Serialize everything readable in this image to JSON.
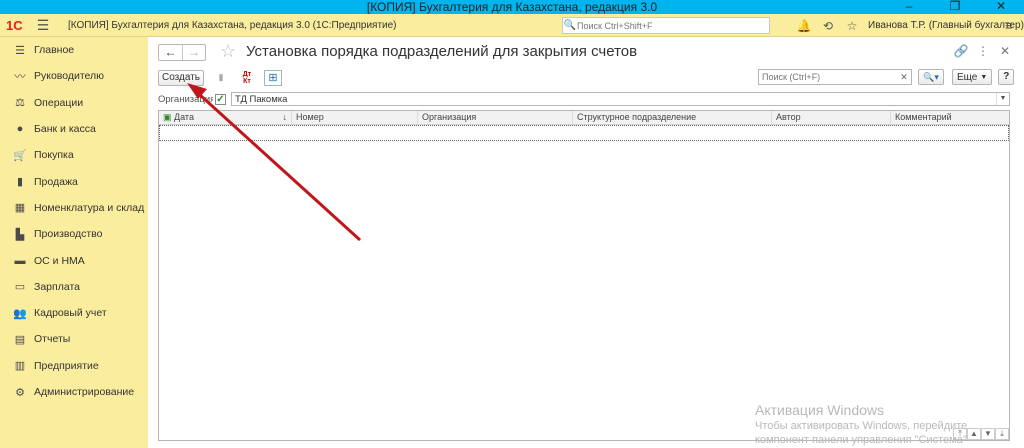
{
  "os": {
    "title": "[КОПИЯ] Бухгалтерия для Казахстана, редакция 3.0"
  },
  "header": {
    "logo": "1С",
    "app_name": "[КОПИЯ] Бухгалтерия для Казахстана, редакция 3.0  (1С:Предприятие)",
    "search_placeholder": "Поиск Ctrl+Shift+F",
    "user": "Иванова Т.Р. (Главный бухгалтер)"
  },
  "sidebar": {
    "items": [
      {
        "label": "Главное",
        "icon": "menu-icon"
      },
      {
        "label": "Руководителю",
        "icon": "trend-icon"
      },
      {
        "label": "Операции",
        "icon": "operations-icon"
      },
      {
        "label": "Банк и касса",
        "icon": "bank-icon"
      },
      {
        "label": "Покупка",
        "icon": "cart-icon"
      },
      {
        "label": "Продажа",
        "icon": "bag-icon"
      },
      {
        "label": "Номенклатура и склад",
        "icon": "warehouse-icon"
      },
      {
        "label": "Производство",
        "icon": "factory-icon"
      },
      {
        "label": "ОС и НМА",
        "icon": "truck-icon"
      },
      {
        "label": "Зарплата",
        "icon": "salary-icon"
      },
      {
        "label": "Кадровый учет",
        "icon": "people-icon"
      },
      {
        "label": "Отчеты",
        "icon": "report-icon"
      },
      {
        "label": "Предприятие",
        "icon": "enterprise-icon"
      },
      {
        "label": "Администрирование",
        "icon": "gear-icon"
      }
    ]
  },
  "page": {
    "title": "Установка порядка подразделений для закрытия счетов",
    "create_label": "Создать",
    "list_search_placeholder": "Поиск (Ctrl+F)",
    "more_label": "Еще",
    "help_label": "?",
    "dt_label": "Дт",
    "kt_label": "Кт"
  },
  "filter": {
    "label": "Организация:",
    "value": "ТД Пакомка",
    "checked": true
  },
  "table": {
    "columns": [
      "Дата",
      "Номер",
      "Организация",
      "Структурное подразделение",
      "Автор",
      "Комментарий"
    ],
    "rows": []
  },
  "watermark": {
    "line1": "Активация Windows",
    "line2": "Чтобы активировать Windows, перейдите",
    "line3": "компонент панели управления \"Система\""
  },
  "colors": {
    "header_bg": "#fbed9e",
    "os_titlebar": "#00b4f0",
    "annotation_arrow": "#c0161b"
  }
}
